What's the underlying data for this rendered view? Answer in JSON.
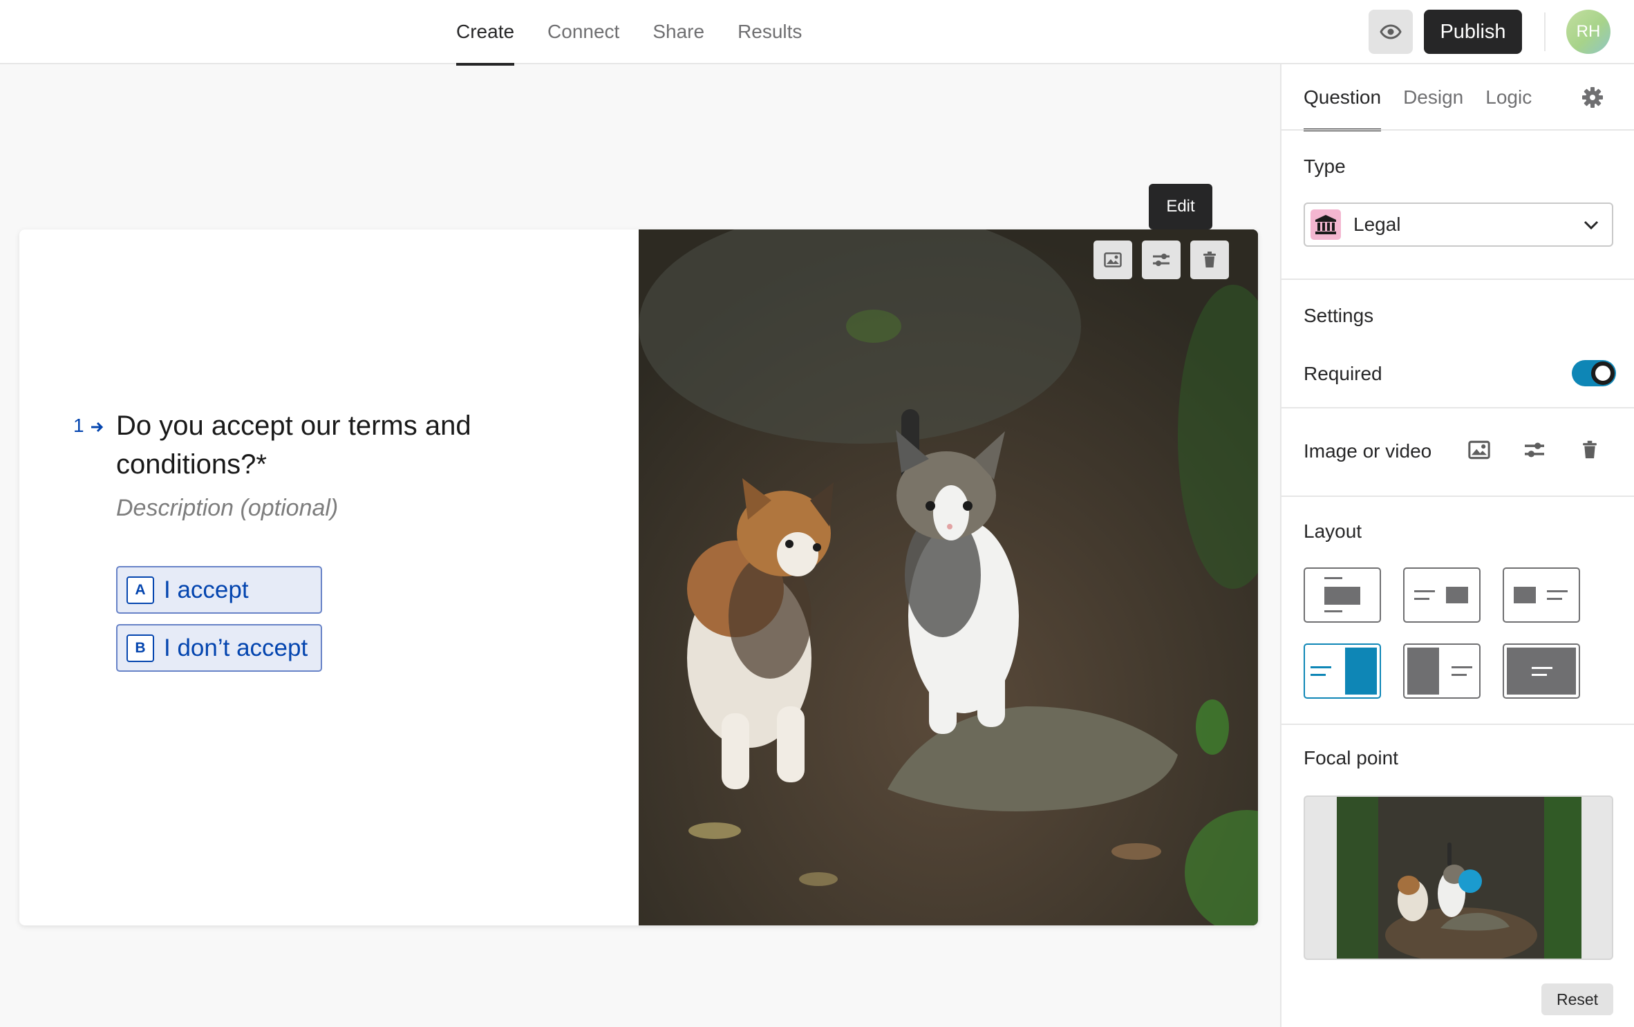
{
  "nav": {
    "tabs": [
      {
        "label": "Create",
        "active": true
      },
      {
        "label": "Connect",
        "active": false
      },
      {
        "label": "Share",
        "active": false
      },
      {
        "label": "Results",
        "active": false
      }
    ],
    "preview_icon": "eye-icon",
    "publish_label": "Publish",
    "avatar_initials": "RH"
  },
  "question": {
    "number": "1",
    "arrow_icon": "arrow-right-icon",
    "title": "Do you accept our terms and conditions?*",
    "description_placeholder": "Description (optional)",
    "choices": [
      {
        "key": "A",
        "label": "I accept"
      },
      {
        "key": "B",
        "label": "I don’t accept"
      }
    ]
  },
  "media": {
    "tooltip": "Edit",
    "tools": [
      "image-icon",
      "adjust-sliders-icon",
      "trash-icon"
    ],
    "image_subject": "two kittens walking on a forest path"
  },
  "panel": {
    "tabs": [
      {
        "label": "Question",
        "active": true
      },
      {
        "label": "Design",
        "active": false
      },
      {
        "label": "Logic",
        "active": false
      }
    ],
    "settings_icon": "gear-icon",
    "type": {
      "title": "Type",
      "value": "Legal",
      "icon": "bank-icon",
      "icon_color": "#f3b6d0"
    },
    "settings": {
      "title": "Settings",
      "required_label": "Required",
      "required_on": true
    },
    "image_or_video": {
      "label": "Image or video",
      "tools": [
        "image-icon",
        "adjust-sliders-icon",
        "trash-icon"
      ]
    },
    "layout": {
      "title": "Layout",
      "options": [
        "stack",
        "split-right-small",
        "split-left-small",
        "split-right-full",
        "split-left-full",
        "background"
      ],
      "selected_index": 3
    },
    "focal_point": {
      "title": "Focal point",
      "reset_label": "Reset"
    }
  },
  "colors": {
    "accent": "#0445af",
    "toggle": "#0e86b6",
    "focal_dot": "#1b9bcf",
    "dark": "#262627"
  }
}
